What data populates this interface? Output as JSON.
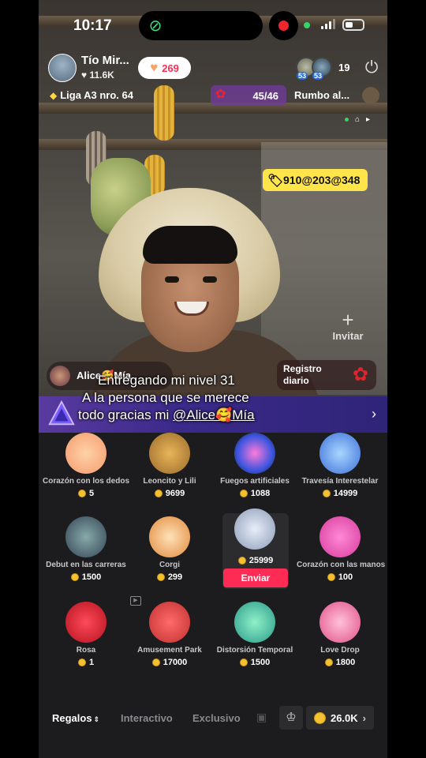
{
  "status": {
    "time": "10:17"
  },
  "host": {
    "name": "Tío Mir...",
    "likes": "11.6K"
  },
  "likes_pill": {
    "count": "269"
  },
  "viewers": {
    "badge_1": "53",
    "badge_2": "53",
    "count": "19"
  },
  "league": {
    "label": "Liga A3 nro. 64"
  },
  "rose_goal": {
    "progress": "45/46"
  },
  "rumbo": {
    "label": "Rumbo al..."
  },
  "code_badge": {
    "text": "910@203@348"
  },
  "invite": {
    "label": "Invitar"
  },
  "pinned_user": {
    "name": "Alice🥰Mía"
  },
  "registro": {
    "label": "Registro diario"
  },
  "caption": {
    "line1": "Entregando mi nivel 31",
    "line2": "A la persona que se merece",
    "line3_prefix": "todo gracias mi ",
    "mention": "@Alice🥰Mía"
  },
  "gifts": [
    {
      "name": "Corazón con los dedos",
      "price": "5",
      "icon": "finger-heart-icon"
    },
    {
      "name": "Leoncito y Lili",
      "price": "9699",
      "icon": "lion-icon"
    },
    {
      "name": "Fuegos artificiales",
      "price": "1088",
      "icon": "fireworks-icon"
    },
    {
      "name": "Travesía Interestelar",
      "price": "14999",
      "icon": "interstellar-icon"
    },
    {
      "name": "Debut en las carreras",
      "price": "1500",
      "icon": "race-car-icon"
    },
    {
      "name": "Corgi",
      "price": "299",
      "icon": "corgi-icon"
    },
    {
      "name": "",
      "price": "25999",
      "icon": "astronaut-icon"
    },
    {
      "name": "Corazón con las manos",
      "price": "100",
      "icon": "hand-heart-icon"
    },
    {
      "name": "Rosa",
      "price": "1",
      "icon": "rose-icon"
    },
    {
      "name": "Amusement Park",
      "price": "17000",
      "icon": "amusement-park-icon"
    },
    {
      "name": "Distorsión Temporal",
      "price": "1500",
      "icon": "time-warp-icon"
    },
    {
      "name": "Love Drop",
      "price": "1800",
      "icon": "love-drop-icon"
    }
  ],
  "send_button": {
    "label": "Enviar"
  },
  "tabs": {
    "regalos": "Regalos",
    "interactivo": "Interactivo",
    "exclusivo": "Exclusivo"
  },
  "balance": {
    "amount": "26.0K"
  },
  "colors": {
    "accent": "#fe2c55",
    "coin": "#f4c131",
    "badge_yellow": "#ffe54a",
    "banner": "#3b2a8a"
  }
}
